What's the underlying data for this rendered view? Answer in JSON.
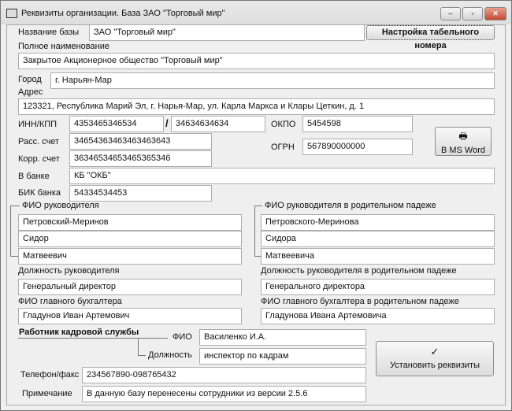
{
  "window": {
    "title": "Реквизиты организации. База ЗАО \"Торговый мир\"",
    "minimize": "–",
    "maximize": "▫",
    "close": "✕"
  },
  "base_name": {
    "label": "Название базы",
    "value": "ЗАО \"Торговый мир\"",
    "button": "Настройка табельного номера"
  },
  "full_name": {
    "label": "Полное наименование",
    "value": "Закрытое Акционерное общество \"Торговый мир\""
  },
  "city": {
    "label": "Город",
    "value": "г. Нарьян-Мар"
  },
  "address": {
    "label": "Адрес",
    "value": "123321, Республика Марий Эл, г. Нарья-Мар, ул. Карла Маркса и Клары Цеткин, д. 1"
  },
  "inn": {
    "label": "ИНН/КПП",
    "inn": "4353465346534",
    "sep": "/",
    "kpp": "34634634634"
  },
  "okpo": {
    "label": "ОКПО",
    "value": "5454598"
  },
  "ogrn": {
    "label": "ОГРН",
    "value": "567890000000"
  },
  "account": {
    "label": "Расс. счет",
    "value": "34654363463463463643"
  },
  "corr": {
    "label": "Корр. счет",
    "value": "36346534653465365346"
  },
  "bank": {
    "label": "В банке",
    "value": "КБ \"ОКБ\""
  },
  "bik": {
    "label": "БИК банка",
    "value": "54334534453"
  },
  "word_button": {
    "label": "В MS Word",
    "icon": "printer-icon"
  },
  "director": {
    "label": "ФИО руководителя",
    "last": "Петровский-Меринов",
    "first": "Сидор",
    "middle": "Матвеевич"
  },
  "director_gen": {
    "label": "ФИО руководителя в родительном падеже",
    "last": "Петровского-Меринова",
    "first": "Сидора",
    "middle": "Матвеевича"
  },
  "position": {
    "label": "Должность руководителя",
    "value": "Генеральный директор"
  },
  "position_gen": {
    "label": "Должность руководителя в родительном падеже",
    "value": "Генерального директора"
  },
  "accountant": {
    "label": "ФИО главного бухгалтера",
    "value": "Гладунов Иван Артемович"
  },
  "accountant_gen": {
    "label": "ФИО главного бухгалтера в родительном падеже",
    "value": "Гладунова Ивана Артемовича"
  },
  "hr": {
    "label": "Работник кадровой службы",
    "fio_label": "ФИО",
    "fio": "Василенко И.А.",
    "pos_label": "Должность",
    "pos": "инспектор по кадрам"
  },
  "phone": {
    "label": "Телефон/факс",
    "value": "234567890-098765432"
  },
  "note": {
    "label": "Примечание",
    "value": "В данную базу перенесены сотрудники из версии 2.5.6"
  },
  "set_button": {
    "label": "Установить реквизиты",
    "icon": "check-icon",
    "glyph": "✓"
  }
}
